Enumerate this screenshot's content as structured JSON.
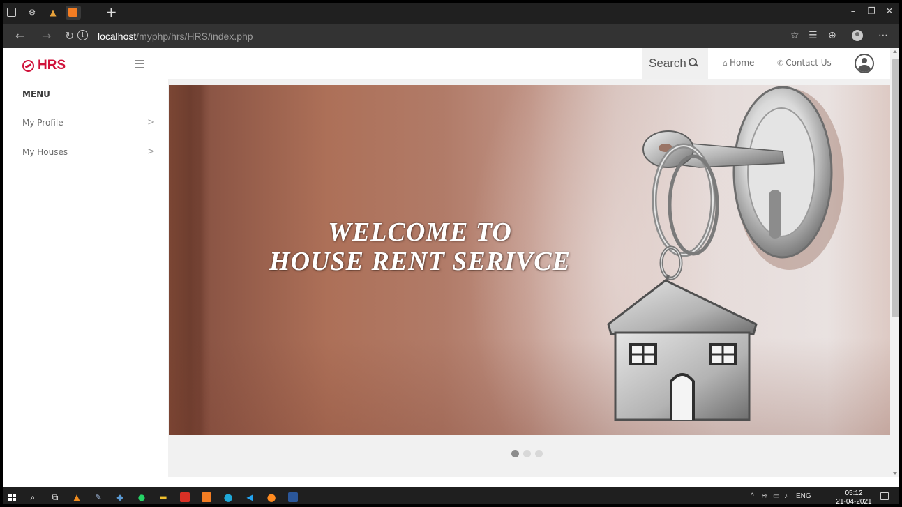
{
  "browser": {
    "url_host": "localhost",
    "url_path": "/myphp/hrs/HRS/index.php",
    "new_tab_glyph": "+",
    "tab_icons": [
      "tab-actions-icon",
      "settings-gear-icon",
      "matlab-icon",
      "xampp-icon"
    ]
  },
  "app": {
    "logo_text": "HRS",
    "brand_color": "#d0123a"
  },
  "sidebar": {
    "menu_title": "MENU",
    "items": [
      {
        "label": "My Profile",
        "chevron": ">"
      },
      {
        "label": "My Houses",
        "chevron": ">"
      }
    ]
  },
  "topnav": {
    "search_label": "Search",
    "home_label": "Home",
    "contact_label": "Contact Us"
  },
  "hero": {
    "line1": "WELCOME TO",
    "line2": "HOUSE RENT SERIVCE"
  },
  "carousel": {
    "slide_count": 3,
    "active_index": 0
  },
  "taskbar": {
    "language": "ENG",
    "time": "05:12",
    "date": "21-04-2021"
  }
}
